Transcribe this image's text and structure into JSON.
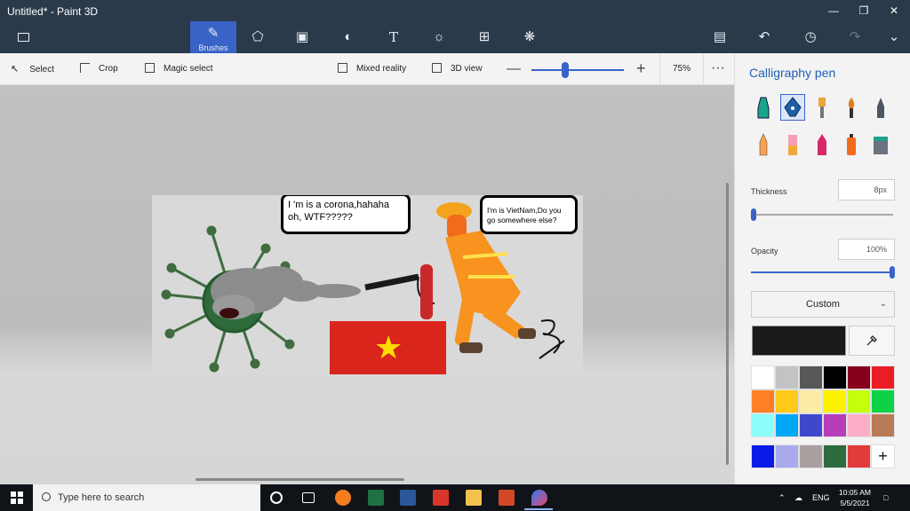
{
  "window": {
    "title": "Untitled* - Paint 3D"
  },
  "ribbon": {
    "brushes_label": "Brushes"
  },
  "toolbar": {
    "select": "Select",
    "crop": "Crop",
    "magic_select": "Magic select",
    "mixed_reality": "Mixed reality",
    "view_3d": "3D view",
    "zoom": "75%",
    "zoom_fraction": 0.38
  },
  "canvas": {
    "bubble_corona": "I 'm is a corona,hahaha oh, WTF?????",
    "bubble_vietnam": "I'm is VietNam,Do you go somewhere else?"
  },
  "panel": {
    "title": "Calligraphy pen",
    "thickness_label": "Thickness",
    "thickness_value": "8px",
    "opacity_label": "Opacity",
    "opacity_value": "100%",
    "color_mode": "Custom",
    "current_color": "#1a1a1a",
    "palette": [
      "#ffffff",
      "#c3c3c3",
      "#585858",
      "#000000",
      "#88001b",
      "#ec1c24",
      "#ff7f27",
      "#ffca18",
      "#fdeca6",
      "#fff200",
      "#c4ff0e",
      "#0ed145",
      "#8cfffb",
      "#00a8f3",
      "#3f48cc",
      "#b83dba",
      "#ffaec8",
      "#b97a56"
    ],
    "custom_colors": [
      "#0a1be8",
      "#a9aaed",
      "#a9a0a0",
      "#2e6b3e",
      "#e03c3c"
    ]
  },
  "taskbar": {
    "search_placeholder": "Type here to search",
    "language": "ENG",
    "time": "10:05 AM",
    "date": "5/5/2021"
  }
}
